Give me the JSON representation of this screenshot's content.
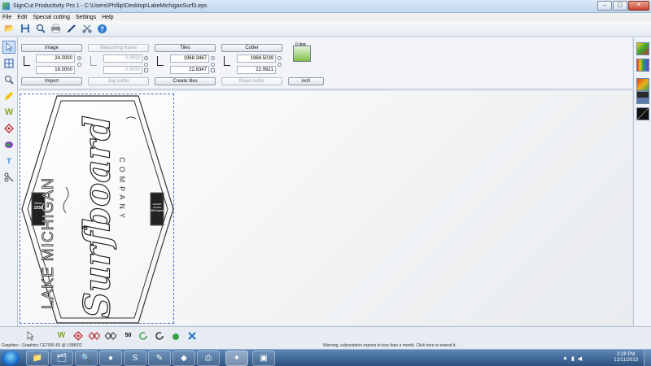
{
  "window": {
    "title": "SignCut Productivity Pro 1 - C:\\Users\\Phillip\\Desktop\\LakeMichiganSurf3.eps",
    "minimize": "–",
    "maximize": "▢",
    "close": "✕"
  },
  "menu": [
    "File",
    "Edit",
    "Special cutting",
    "Settings",
    "Help"
  ],
  "props": {
    "image_label": "Image",
    "image_w": "24.0000",
    "image_h": "16.0000",
    "measuring_frame_label": "Measuring frame",
    "mf_w": "0.0000",
    "mf_h": "0.0000",
    "tiles_label": "Tiles",
    "tiles_w": "1968.3467",
    "tiles_h": "22.8347",
    "cutter_label": "Cutter",
    "cutter_w": "1968.5039",
    "cutter_h": "22.9921",
    "import_label": "Import",
    "jog_cutter_label": "Jog cutter",
    "create_tiles_label": "Create tiles",
    "read_cutter_label": "Read cutter",
    "unit_label": "inch",
    "plotter_deg": "0 deg"
  },
  "artwork": {
    "top_line": "LAKE MICHIGAN",
    "main": "Surfboard",
    "bottom_line": "COMPANY",
    "badge_left_1": "Since",
    "badge_left_2": "1936",
    "badge_right_1": "GRAND HAVEN",
    "badge_right_2": "Michigan"
  },
  "status": {
    "left": "Graphtec - Graphtec CE7000-60 @ USB002",
    "warning": "Warning, subscription expires in less than a month. Click here to extend it."
  },
  "taskbar": {
    "time": "3:28 PM",
    "date": "12/11/2013"
  }
}
